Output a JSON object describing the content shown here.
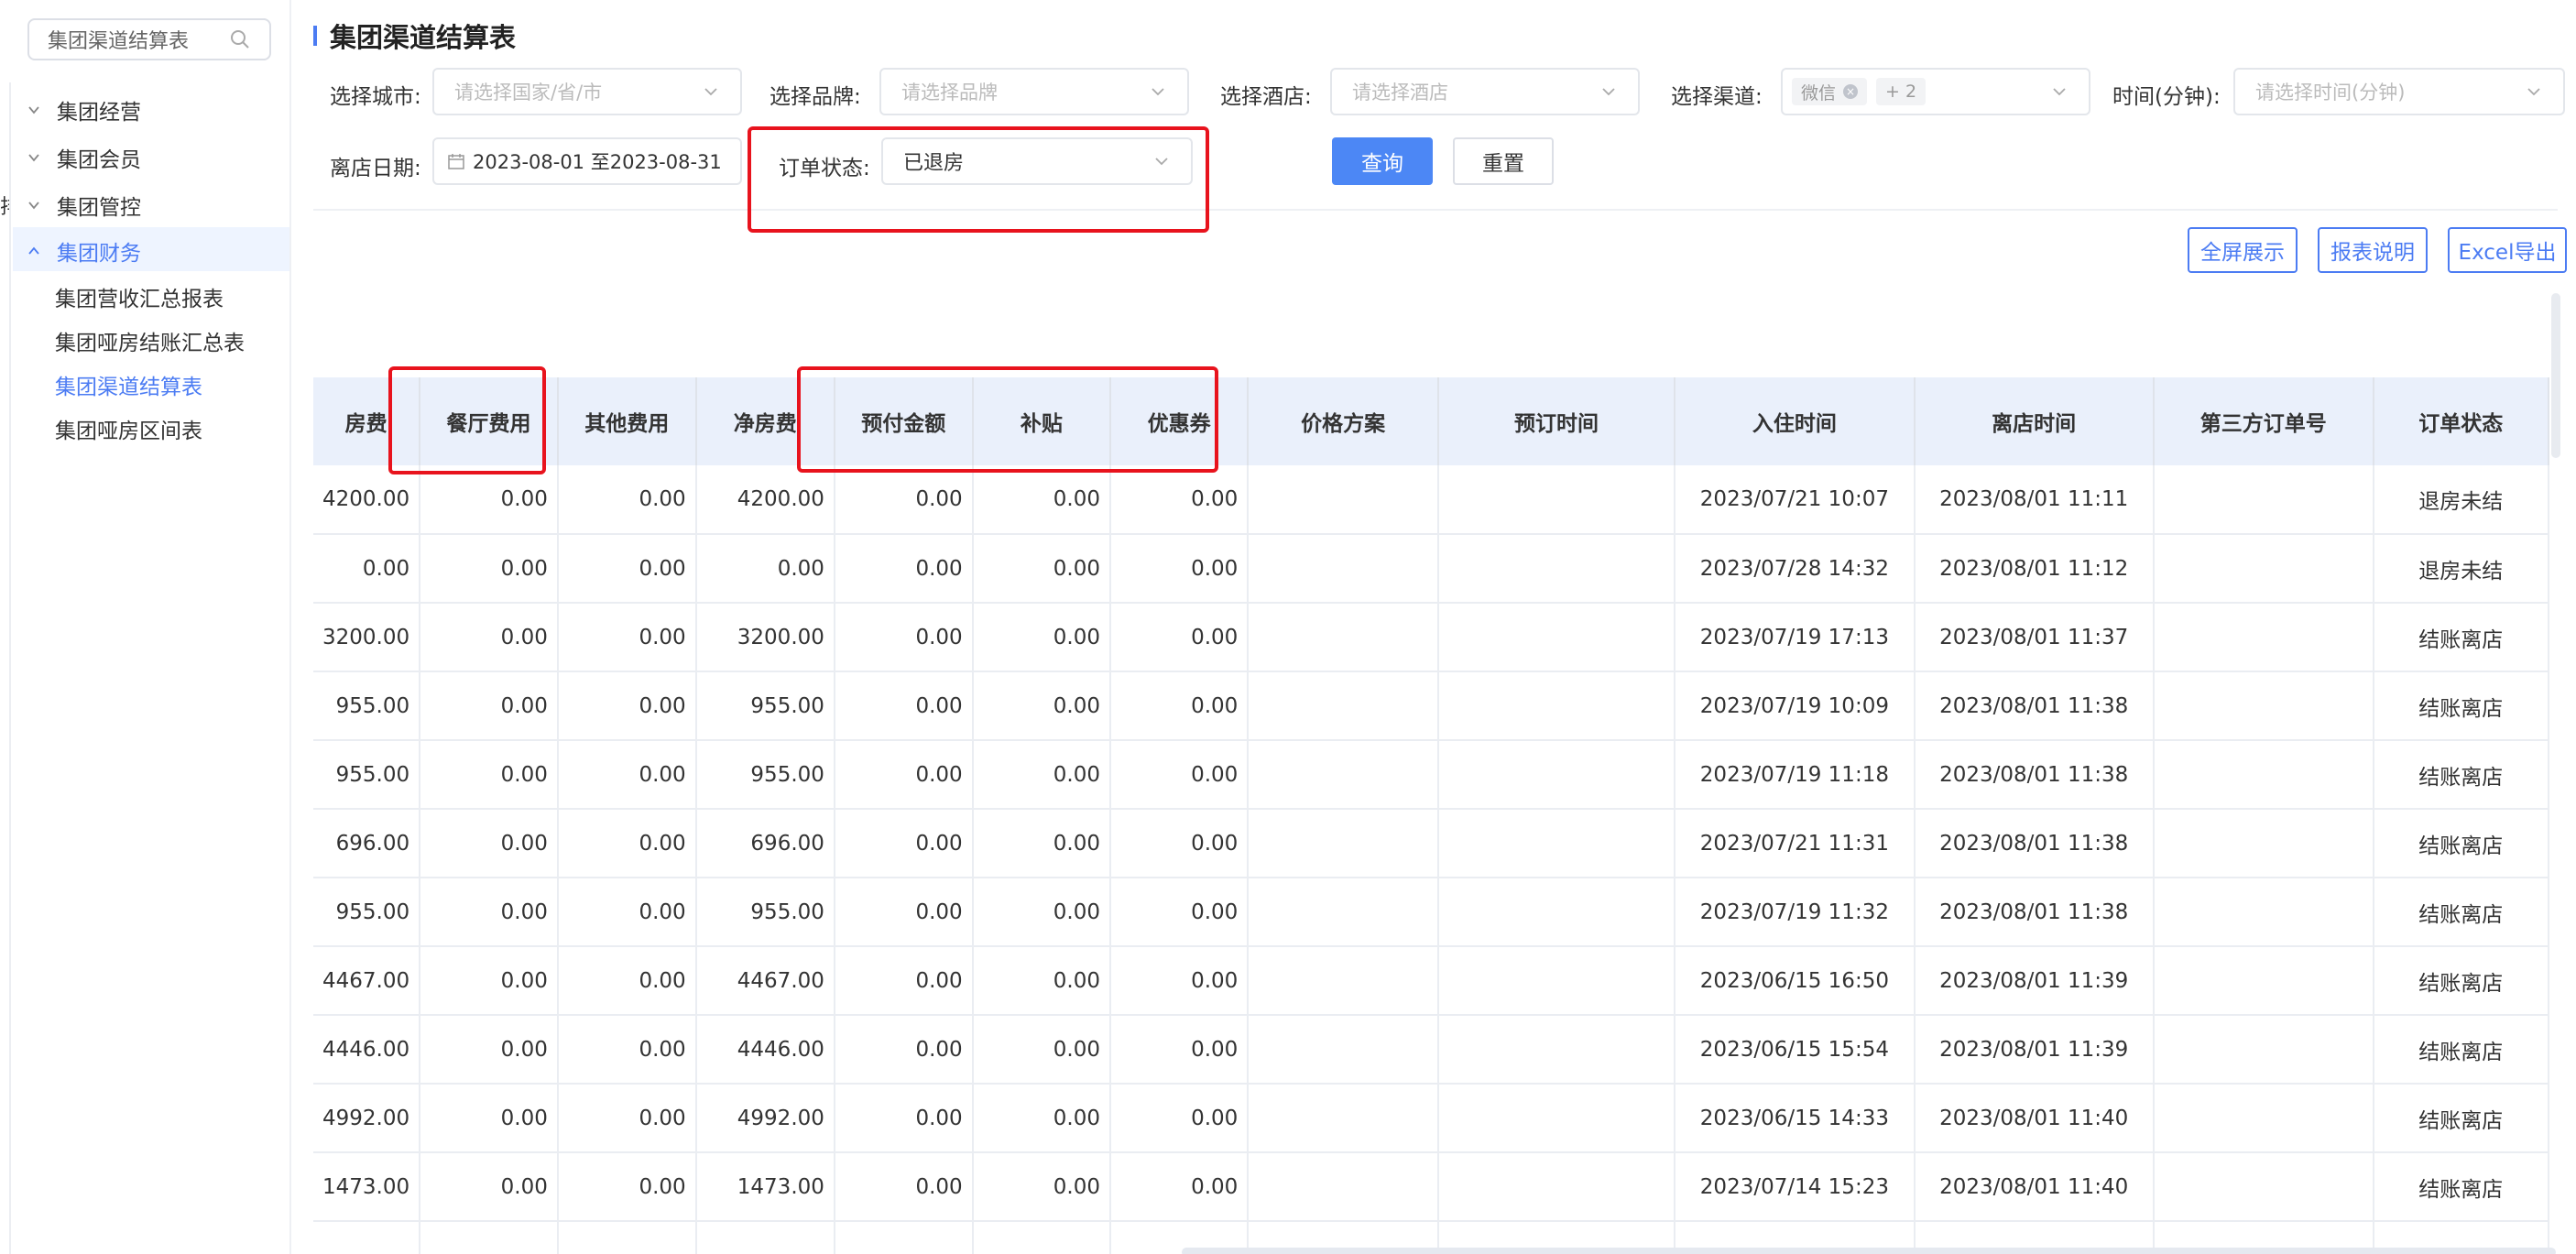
{
  "sidebar": {
    "search_placeholder": "集团渠道结算表",
    "cut_text": "排",
    "groups": [
      {
        "label": "集团经营"
      },
      {
        "label": "集团会员"
      },
      {
        "label": "集团管控"
      },
      {
        "label": "集团财务"
      }
    ],
    "sub_items": [
      {
        "label": "集团营收汇总报表"
      },
      {
        "label": "集团哑房结账汇总表"
      },
      {
        "label": "集团渠道结算表"
      },
      {
        "label": "集团哑房区间表"
      }
    ]
  },
  "page": {
    "title": "集团渠道结算表"
  },
  "filters": {
    "city": {
      "label": "选择城市:",
      "placeholder": "请选择国家/省/市"
    },
    "brand": {
      "label": "选择品牌:",
      "placeholder": "请选择品牌"
    },
    "hotel": {
      "label": "选择酒店:",
      "placeholder": "请选择酒店"
    },
    "channel": {
      "label": "选择渠道:",
      "tag1": "微信",
      "tag2": "+ 2"
    },
    "time": {
      "label": "时间(分钟):",
      "placeholder": "请选择时间(分钟)"
    },
    "checkout_date": {
      "label": "离店日期:",
      "value": "2023-08-01 至2023-08-31"
    },
    "order_status": {
      "label": "订单状态:",
      "value": "已退房"
    }
  },
  "buttons": {
    "query": "查询",
    "reset": "重置",
    "fullscreen": "全屏展示",
    "report_desc": "报表说明",
    "excel": "Excel导出"
  },
  "table": {
    "columns": [
      "房费",
      "餐厅费用",
      "其他费用",
      "净房费",
      "预付金额",
      "补贴",
      "优惠券",
      "价格方案",
      "预订时间",
      "入住时间",
      "离店时间",
      "第三方订单号",
      "订单状态"
    ],
    "rows": [
      [
        "4200.00",
        "0.00",
        "0.00",
        "4200.00",
        "0.00",
        "0.00",
        "0.00",
        "",
        "",
        "2023/07/21 10:07",
        "2023/08/01 11:11",
        "",
        "退房未结"
      ],
      [
        "0.00",
        "0.00",
        "0.00",
        "0.00",
        "0.00",
        "0.00",
        "0.00",
        "",
        "",
        "2023/07/28 14:32",
        "2023/08/01 11:12",
        "",
        "退房未结"
      ],
      [
        "3200.00",
        "0.00",
        "0.00",
        "3200.00",
        "0.00",
        "0.00",
        "0.00",
        "",
        "",
        "2023/07/19 17:13",
        "2023/08/01 11:37",
        "",
        "结账离店"
      ],
      [
        "955.00",
        "0.00",
        "0.00",
        "955.00",
        "0.00",
        "0.00",
        "0.00",
        "",
        "",
        "2023/07/19 10:09",
        "2023/08/01 11:38",
        "",
        "结账离店"
      ],
      [
        "955.00",
        "0.00",
        "0.00",
        "955.00",
        "0.00",
        "0.00",
        "0.00",
        "",
        "",
        "2023/07/19 11:18",
        "2023/08/01 11:38",
        "",
        "结账离店"
      ],
      [
        "696.00",
        "0.00",
        "0.00",
        "696.00",
        "0.00",
        "0.00",
        "0.00",
        "",
        "",
        "2023/07/21 11:31",
        "2023/08/01 11:38",
        "",
        "结账离店"
      ],
      [
        "955.00",
        "0.00",
        "0.00",
        "955.00",
        "0.00",
        "0.00",
        "0.00",
        "",
        "",
        "2023/07/19 11:32",
        "2023/08/01 11:38",
        "",
        "结账离店"
      ],
      [
        "4467.00",
        "0.00",
        "0.00",
        "4467.00",
        "0.00",
        "0.00",
        "0.00",
        "",
        "",
        "2023/06/15 16:50",
        "2023/08/01 11:39",
        "",
        "结账离店"
      ],
      [
        "4446.00",
        "0.00",
        "0.00",
        "4446.00",
        "0.00",
        "0.00",
        "0.00",
        "",
        "",
        "2023/06/15 15:54",
        "2023/08/01 11:39",
        "",
        "结账离店"
      ],
      [
        "4992.00",
        "0.00",
        "0.00",
        "4992.00",
        "0.00",
        "0.00",
        "0.00",
        "",
        "",
        "2023/06/15 14:33",
        "2023/08/01 11:40",
        "",
        "结账离店"
      ],
      [
        "1473.00",
        "0.00",
        "0.00",
        "1473.00",
        "0.00",
        "0.00",
        "0.00",
        "",
        "",
        "2023/07/14 15:23",
        "2023/08/01 11:40",
        "",
        "结账离店"
      ],
      [
        "",
        "",
        "",
        "",
        "",
        "",
        "",
        "",
        "",
        "",
        "",
        "",
        ""
      ]
    ]
  },
  "colors": {
    "accent": "#4c7cf3",
    "highlight_box": "#e8131d",
    "header_bg": "#eaf0fb"
  }
}
